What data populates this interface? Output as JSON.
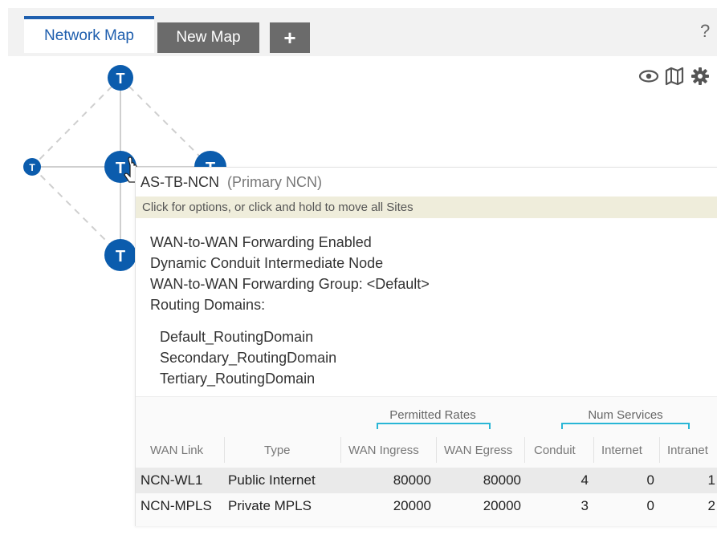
{
  "tabs": [
    {
      "label": "Network Map"
    },
    {
      "label": "New Map"
    }
  ],
  "add_tab_label": "+",
  "help_label": "?",
  "toolbar_icons": [
    "eye-icon",
    "map-icon",
    "gear-icon"
  ],
  "node_letter": "T",
  "popup": {
    "site_name": "AS-TB-NCN",
    "site_role": "(Primary NCN)",
    "hint": "Click for options, or click and hold to move all Sites",
    "properties": [
      "WAN-to-WAN Forwarding Enabled",
      "Dynamic Conduit Intermediate Node",
      "WAN-to-WAN Forwarding Group: <Default>",
      "Routing Domains:"
    ],
    "routing_domains": [
      "Default_RoutingDomain",
      "Secondary_RoutingDomain",
      "Tertiary_RoutingDomain"
    ],
    "table": {
      "group_headers": {
        "permitted_rates": "Permitted Rates",
        "num_services": "Num Services"
      },
      "columns": [
        "WAN Link",
        "Type",
        "WAN Ingress",
        "WAN Egress",
        "Conduit",
        "Internet",
        "Intranet"
      ],
      "rows": [
        {
          "wan_link": "NCN-WL1",
          "type": "Public Internet",
          "wan_ingress": "80000",
          "wan_egress": "80000",
          "conduit": "4",
          "internet": "0",
          "intranet": "1"
        },
        {
          "wan_link": "NCN-MPLS",
          "type": "Private MPLS",
          "wan_ingress": "20000",
          "wan_egress": "20000",
          "conduit": "3",
          "internet": "0",
          "intranet": "2"
        }
      ]
    }
  },
  "colors": {
    "accent": "#1f5fae",
    "node": "#0b5cad",
    "bracket": "#29b6d6",
    "hint_bg": "#efeddb",
    "tab_inactive": "#6b6b6b"
  }
}
